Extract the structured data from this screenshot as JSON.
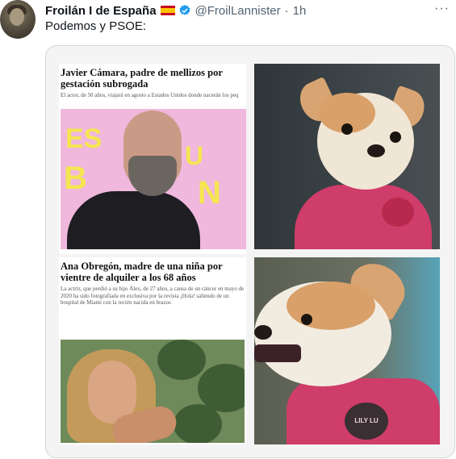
{
  "tweet": {
    "author_name": "Froilán I de España",
    "handle": "@FroilLannister",
    "time": "1h",
    "separator": "·",
    "more": "···",
    "text": "Podemos y PSOE:"
  },
  "media": {
    "news1": {
      "headline": "Javier Cámara, padre de mellizos por gestación subrogada",
      "subtitle": "El actor, de 50 años, viajará en agosto a Estados Unidos donde nacerán los peq"
    },
    "news2": {
      "headline": "Ana Obregón, madre de una niña por vientre de alquiler a los 68 años",
      "subtitle": "La actriz, que perdió a su hijo Álex, de 27 años, a causa de un cáncer en mayo de 2020 ha sido fotografiada en exclusiva por la revista ¡Hola! saliendo de un hospital de Miami con la recién nacida en brazos"
    },
    "photo1_sign": [
      "ES",
      "U",
      "B",
      "N"
    ],
    "dog2_tag": "LILY LU"
  },
  "colors": {
    "verified": "#1d9bf0",
    "handle": "#536471",
    "sweater": "#cf3d6a",
    "backdrop": "#f0b8dc"
  }
}
